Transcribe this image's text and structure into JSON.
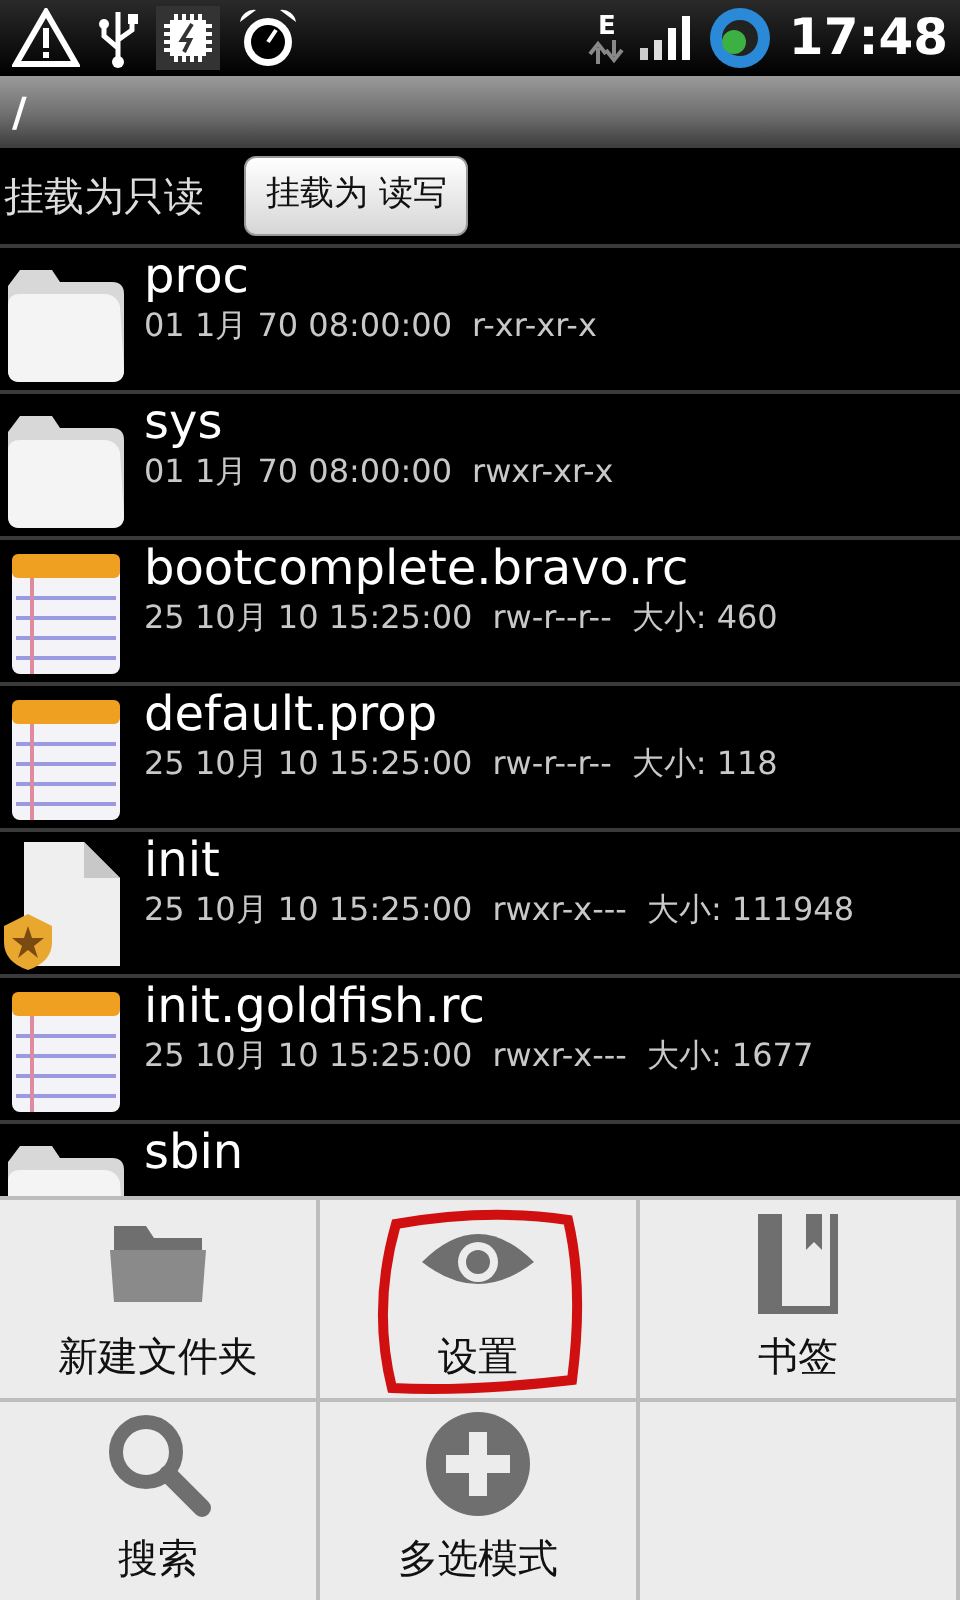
{
  "status_bar": {
    "network_type": "E",
    "time": "17:48"
  },
  "path_bar": {
    "path": "/"
  },
  "mount": {
    "status": "挂载为只读",
    "button": "挂载为 读写"
  },
  "files": [
    {
      "kind": "folder",
      "name": "proc",
      "date": "01 1月 70 08:00:00",
      "permissions": "r-xr-xr-x"
    },
    {
      "kind": "folder",
      "name": "sys",
      "date": "01 1月 70 08:00:00",
      "permissions": "rwxr-xr-x"
    },
    {
      "kind": "text",
      "name": "bootcomplete.bravo.rc",
      "date": "25 10月 10 15:25:00",
      "permissions": "rw-r--r--",
      "size": "大小: 460"
    },
    {
      "kind": "text",
      "name": "default.prop",
      "date": "25 10月 10 15:25:00",
      "permissions": "rw-r--r--",
      "size": "大小: 118"
    },
    {
      "kind": "executable",
      "name": "init",
      "date": "25 10月 10 15:25:00",
      "permissions": "rwxr-x---",
      "size": "大小: 111948"
    },
    {
      "kind": "text",
      "name": "init.goldfish.rc",
      "date": "25 10月 10 15:25:00",
      "permissions": "rwxr-x---",
      "size": "大小: 1677"
    },
    {
      "kind": "folder",
      "name": "sbin"
    }
  ],
  "menu": [
    {
      "kind": "new-folder",
      "label": "新建文件夹",
      "circled": false
    },
    {
      "kind": "settings",
      "label": "设置",
      "circled": true
    },
    {
      "kind": "bookmarks",
      "label": "书签",
      "circled": false
    },
    {
      "kind": "search",
      "label": "搜索",
      "circled": false
    },
    {
      "kind": "multi-select",
      "label": "多选模式",
      "circled": false
    }
  ]
}
